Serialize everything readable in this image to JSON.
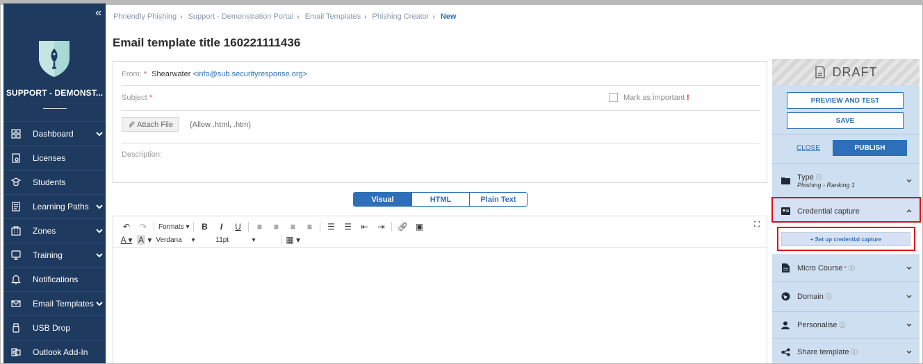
{
  "sidebar": {
    "collapse_glyph": "«",
    "org_name": "SUPPORT - DEMONST...",
    "items": [
      {
        "label": "Dashboard",
        "icon": "dashboard-icon",
        "has_chevron": true
      },
      {
        "label": "Licenses",
        "icon": "licenses-icon",
        "has_chevron": false
      },
      {
        "label": "Students",
        "icon": "students-icon",
        "has_chevron": false
      },
      {
        "label": "Learning Paths",
        "icon": "learning-paths-icon",
        "has_chevron": true
      },
      {
        "label": "Zones",
        "icon": "zones-icon",
        "has_chevron": true
      },
      {
        "label": "Training",
        "icon": "training-icon",
        "has_chevron": true
      },
      {
        "label": "Notifications",
        "icon": "bell-icon",
        "has_chevron": false
      },
      {
        "label": "Email Templates",
        "icon": "email-icon",
        "has_chevron": true
      },
      {
        "label": "USB Drop",
        "icon": "usb-icon",
        "has_chevron": false
      },
      {
        "label": "Outlook Add-In",
        "icon": "outlook-icon",
        "has_chevron": false
      }
    ]
  },
  "breadcrumb": {
    "items": [
      "Phriendly Phishing",
      "Support - Demonstration Portal",
      "Email Templates",
      "Phishing Creator"
    ],
    "current": "New",
    "sep": "›"
  },
  "page": {
    "title": "Email template title 160221111436"
  },
  "form": {
    "from_label": "From:",
    "from_required": "*",
    "from_name": "Shearwater",
    "from_email": "<info@sub.securityresponse.org>",
    "subject_label": "Subject",
    "subject_required": "*",
    "mark_important_label": "Mark as important",
    "mark_important_flag": "!",
    "attach_button": "Attach File",
    "attach_hint": "(Allow .html, .htm)",
    "description_label": "Description:"
  },
  "editor_tabs": [
    {
      "label": "Visual",
      "active": true
    },
    {
      "label": "HTML",
      "active": false
    },
    {
      "label": "Plain Text",
      "active": false
    }
  ],
  "toolbar": {
    "formats_label": "Formats",
    "font_family": "Verdana",
    "font_size": "11pt"
  },
  "right_panel": {
    "status": "DRAFT",
    "preview_button": "PREVIEW AND TEST",
    "save_button": "SAVE",
    "close_link": "CLOSE",
    "publish_button": "PUBLISH",
    "type_label": "Type",
    "type_value": "Phishing - Ranking 1",
    "credential_label": "Credential capture",
    "setup_button": "+ Set up credential capture",
    "micro_course_label": "Micro Course",
    "micro_course_required": "*",
    "domain_label": "Domain",
    "personalise_label": "Personalise",
    "share_label": "Share template",
    "info_glyph": "ⓘ"
  },
  "colors": {
    "sidebar_bg": "#1e3a5f",
    "accent": "#2d6fb8",
    "panel_bg": "#cfdff2",
    "highlight": "#e01010"
  }
}
